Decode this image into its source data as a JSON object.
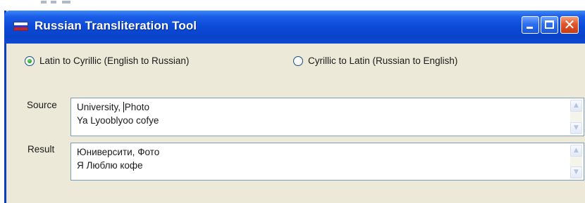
{
  "window": {
    "title": "Russian Transliteration Tool",
    "icons": {
      "app": "russian-flag-icon",
      "minimize": "minimize-icon",
      "maximize": "maximize-icon",
      "close": "close-icon"
    },
    "close_glyph": "✕"
  },
  "mode": {
    "options": [
      {
        "label": "Latin to Cyrillic (English to Russian)",
        "selected": true
      },
      {
        "label": "Cyrillic to Latin (Russian to English)",
        "selected": false
      }
    ]
  },
  "source": {
    "label": "Source",
    "lines": [
      "University, Photo",
      "Ya Lyooblyoo cofye"
    ],
    "caret_after": "University, "
  },
  "result": {
    "label": "Result",
    "lines": [
      "Юниверсити, Фото",
      "Я Люблю кофе"
    ]
  },
  "scrollbar": {
    "up_glyph": "▲",
    "down_glyph": "▼"
  },
  "colors": {
    "titlebar": "#0b49d6",
    "window_bg": "#ece9d8",
    "close_button": "#e0552c",
    "radio_dot": "#21a121",
    "field_border": "#7f9db9"
  }
}
